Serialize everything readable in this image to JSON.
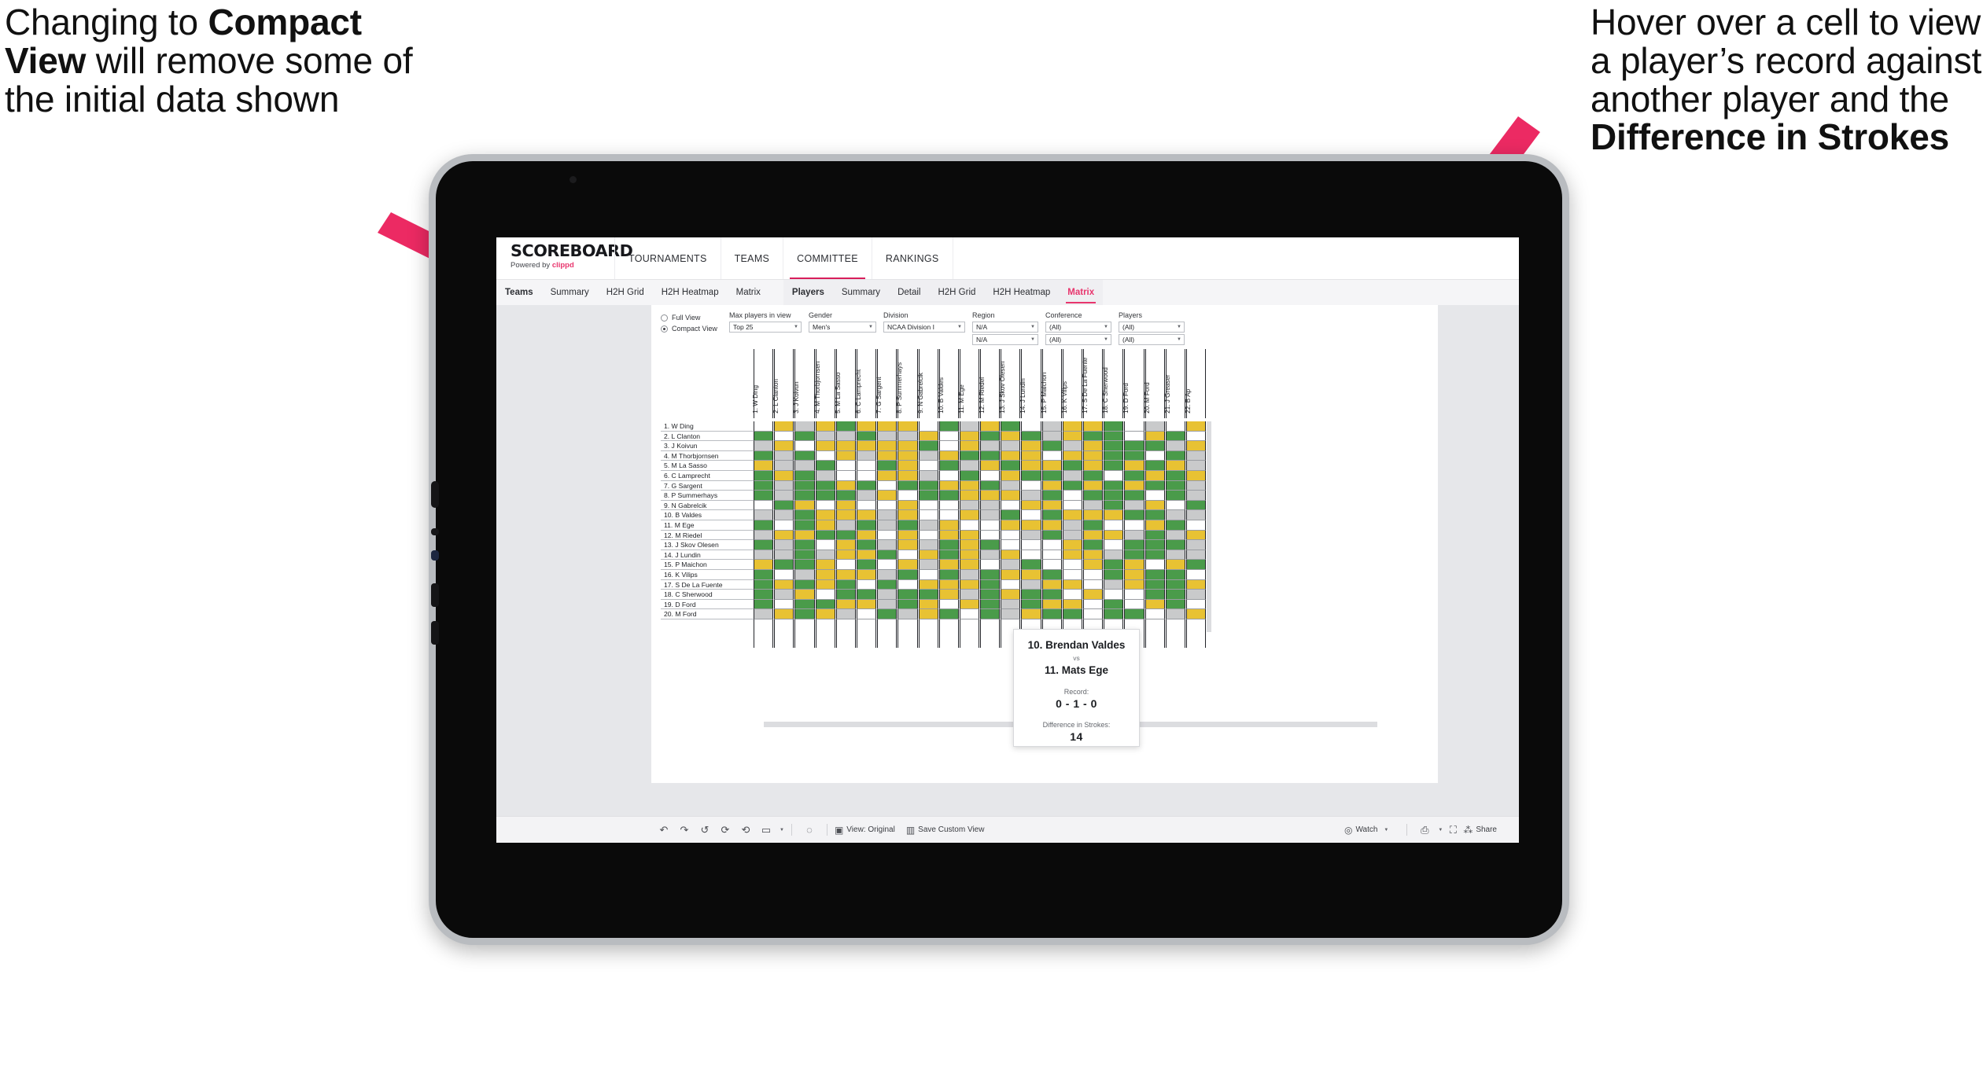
{
  "annotations": {
    "left": {
      "pre": "Changing to ",
      "bold": "Compact View",
      "post": " will remove some of the initial data shown"
    },
    "right": {
      "pre": "Hover over a cell to view a player’s record against another player and the ",
      "bold": "Difference in Strokes",
      "post": ""
    },
    "arrow_color": "#ec2a63"
  },
  "app": {
    "brand": {
      "title": "SCOREBOARD",
      "powered_prefix": "Powered by ",
      "powered_brand": "clippd"
    },
    "main_nav": [
      {
        "label": "TOURNAMENTS",
        "active": false
      },
      {
        "label": "TEAMS",
        "active": false
      },
      {
        "label": "COMMITTEE",
        "active": true
      },
      {
        "label": "RANKINGS",
        "active": false
      }
    ],
    "sub_nav_teams": [
      {
        "label": "Teams",
        "bold": true,
        "active": false
      },
      {
        "label": "Summary",
        "bold": false,
        "active": false
      },
      {
        "label": "H2H Grid",
        "bold": false,
        "active": false
      },
      {
        "label": "H2H Heatmap",
        "bold": false,
        "active": false
      },
      {
        "label": "Matrix",
        "bold": false,
        "active": false
      }
    ],
    "sub_nav_players": [
      {
        "label": "Players",
        "bold": true,
        "active": false
      },
      {
        "label": "Summary",
        "bold": false,
        "active": false
      },
      {
        "label": "Detail",
        "bold": false,
        "active": false
      },
      {
        "label": "H2H Grid",
        "bold": false,
        "active": false
      },
      {
        "label": "H2H Heatmap",
        "bold": false,
        "active": false
      },
      {
        "label": "Matrix",
        "bold": false,
        "active": true
      }
    ],
    "accent_pink": "#e8356d"
  },
  "filters": {
    "view_mode": {
      "options": [
        "Full View",
        "Compact View"
      ],
      "selected": "Compact View"
    },
    "max_players": {
      "label": "Max players in view",
      "value": "Top 25"
    },
    "gender": {
      "label": "Gender",
      "value": "Men's"
    },
    "division": {
      "label": "Division",
      "value": "NCAA Division I"
    },
    "region": {
      "label": "Region",
      "value1": "N/A",
      "value2": "N/A"
    },
    "conference": {
      "label": "Conference",
      "value1": "(All)",
      "value2": "(All)"
    },
    "players": {
      "label": "Players",
      "value1": "(All)",
      "value2": "(All)"
    }
  },
  "matrix": {
    "row_labels": [
      "1. W Ding",
      "2. L Clanton",
      "3. J Koivun",
      "4. M Thorbjornsen",
      "5. M La Sasso",
      "6. C Lamprecht",
      "7. G Sargent",
      "8. P Summerhays",
      "9. N Gabrelcik",
      "10. B Valdes",
      "11. M Ege",
      "12. M Riedel",
      "13. J Skov Olesen",
      "14. J Lundin",
      "15. P Maichon",
      "16. K Vilips",
      "17. S De La Fuente",
      "18. C Sherwood",
      "19. D Ford",
      "20. M Ford"
    ],
    "col_labels": [
      "1. W Ding",
      "2. L Clanton",
      "3. J Koivun",
      "4. M Thorbjornsen",
      "5. M La Sasso",
      "6. C Lamprecht",
      "7. G Sargent",
      "8. P Summerhays",
      "9. N Gabrelcik",
      "10. B Valdes",
      "11. M Ege",
      "12. M Riedel",
      "13. J Skov Olesen",
      "14. J Lundin",
      "15. P Maichon",
      "16. K Vilips",
      "17. S De La Fuente",
      "18. C Sherwood",
      "19. D Ford",
      "20. M Ford",
      "21. J Greaser",
      "22. B Ap"
    ],
    "legend_colors": {
      "win": "#4a9b4a",
      "tie": "#e8c233",
      "loss": "#c9cacb",
      "none": "#ffffff"
    },
    "grid": [
      "wysygyyywgsygwsyygws",
      "gwgssgssywygygsyggwy",
      "sywyyyyygwyssygsyggg",
      "gsgwysyysyggyywyyggw",
      "yssgwwgywgsygyygygyg",
      "gygswwyyswgwyggsgwgy",
      "gsggygwggyygswygygyg",
      "gsgggsywggyyysgwgggw",
      "wgywywwygwsswyywsgsy",
      "ssgyyysywwysgwgyyygg",
      "gwgysgsgsyweyyysgwwy",
      "syyggywywyyywsgsyysg",
      "gsgwygsysgygsweygwgg",
      "ssgsyygwygysygwyysgg",
      "yggywgwysyywsgwwygyw",
      "gwsyyysgwgsgyygwwgyg",
      "gygygwgwyyygwsyywsyg",
      "gsywggsggysgyggwygwg",
      "gwggyysgywygsgyywgwy",
      "sygyswgsygwgsyggwggg"
    ]
  },
  "tooltip": {
    "player_a": "10. Brendan Valdes",
    "vs": "vs",
    "player_b": "11. Mats Ege",
    "record_label": "Record:",
    "record_value": "0 - 1 - 0",
    "diff_label": "Difference in Strokes:",
    "diff_value": "14"
  },
  "toolbar": {
    "icons": [
      "undo-icon",
      "redo-icon",
      "revert-icon",
      "refresh-icon",
      "pause-icon",
      "rect-select-icon"
    ],
    "glyphs": [
      "↶",
      "↷",
      "↺",
      "↻",
      "⎌",
      "▭"
    ],
    "help_glyph": "?",
    "view_label": "View: Original",
    "save_label": "Save Custom View",
    "watch_label": "Watch",
    "share_label": "Share"
  }
}
